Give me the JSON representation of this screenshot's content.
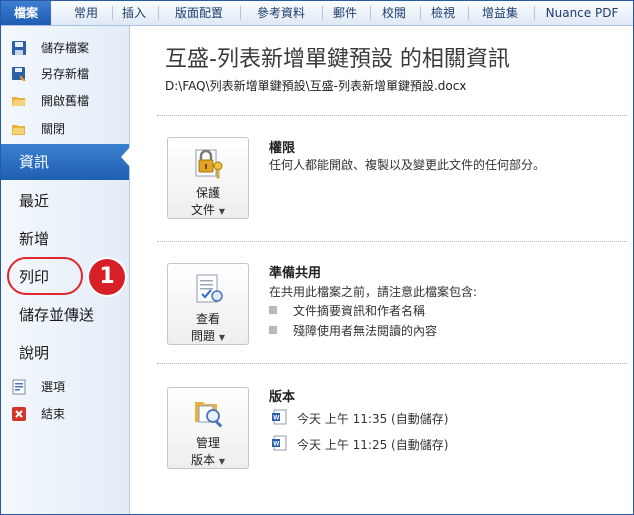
{
  "ribbon": {
    "tabs": [
      "檔案",
      "常用",
      "插入",
      "版面配置",
      "參考資料",
      "郵件",
      "校閱",
      "檢視",
      "增益集",
      "Nuance PDF"
    ]
  },
  "nav": {
    "commands_top": [
      {
        "label": "儲存檔案",
        "icon": "save-icon"
      },
      {
        "label": "另存新檔",
        "icon": "save-as-icon"
      },
      {
        "label": "開啟舊檔",
        "icon": "open-folder-icon"
      },
      {
        "label": "關閉",
        "icon": "close-folder-icon"
      }
    ],
    "items": [
      "資訊",
      "最近",
      "新增",
      "列印",
      "儲存並傳送",
      "說明"
    ],
    "active": "資訊",
    "commands_bottom": [
      {
        "label": "選項",
        "icon": "options-icon"
      },
      {
        "label": "結束",
        "icon": "exit-icon"
      }
    ],
    "callout_number": "1"
  },
  "main": {
    "title": "互盛-列表新增單鍵預設 的相關資訊",
    "path": "D:\\FAQ\\列表新增單鍵預設\\互盛-列表新增單鍵預設.docx",
    "permissions": {
      "button_line1": "保護",
      "button_line2": "文件",
      "heading": "權限",
      "text": "任何人都能開啟、複製以及變更此文件的任何部分。"
    },
    "prepare": {
      "button_line1": "查看",
      "button_line2": "問題",
      "heading": "準備共用",
      "text": "在共用此檔案之前，請注意此檔案包含:",
      "bullets": [
        "文件摘要資訊和作者名稱",
        "殘障使用者無法閱讀的內容"
      ]
    },
    "versions": {
      "button_line1": "管理",
      "button_line2": "版本",
      "heading": "版本",
      "items": [
        "今天 上午 11:35 (自動儲存)",
        "今天 上午 11:25 (自動儲存)"
      ]
    }
  },
  "colors": {
    "accent": "#1f5fb2",
    "callout": "#d61f26",
    "ribbon_text": "#1e3d6b"
  }
}
